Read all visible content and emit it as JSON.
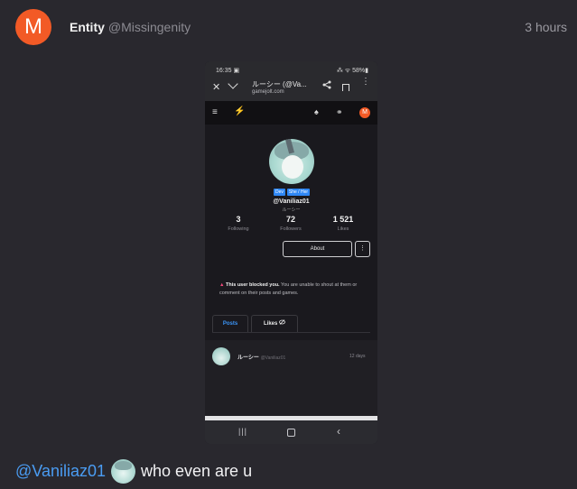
{
  "post": {
    "avatar_letter": "M",
    "author_name": "Entity",
    "author_handle": "@Missingenity",
    "timestamp": "3 hours",
    "comment": {
      "mention": "@Vaniliaz01",
      "text": "who even are u"
    }
  },
  "screenshot": {
    "statusbar": {
      "time": "16:35 ▣",
      "icons": "⁂ ᯤ 58%▮"
    },
    "browser": {
      "close_icon": "✕",
      "title": "ルーシー (@Va...",
      "url": "gamejolt.com",
      "more_icon": "⋮"
    },
    "nav": {
      "menu_icon": "≡",
      "logo_icon": "⚡",
      "tree_icon": "♠",
      "people_icon": "⚭",
      "avatar_letter": "M"
    },
    "profile": {
      "tags": [
        "Dev",
        "She / Her"
      ],
      "username": "@Vaniliaz01",
      "display_name": "ルーシー",
      "stats": {
        "following": {
          "value": "3",
          "label": "Following"
        },
        "followers": {
          "value": "72",
          "label": "Followers"
        },
        "likes": {
          "value": "1 521",
          "label": "Likes"
        }
      },
      "about_label": "About",
      "more_label": "⋮",
      "blocked_icon": "▲",
      "blocked_bold": "This user blocked you.",
      "blocked_text": "You are unable to shout at them or comment on their posts and games."
    },
    "tabs": {
      "posts": "Posts",
      "likes": "Likes"
    },
    "feed_post": {
      "user": "ルーシー",
      "handle": "@Vaniliaz01",
      "age": "12 days"
    },
    "bottom_nav": {
      "recent_icon": "|||",
      "back_icon": "‹"
    }
  }
}
